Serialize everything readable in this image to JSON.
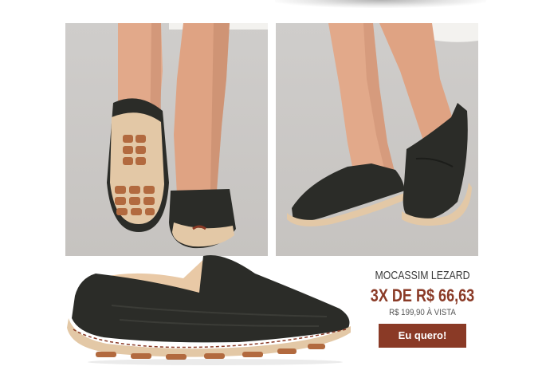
{
  "product": {
    "name": "MOCASSIM LEZARD",
    "installments": "3X DE R$ 66,63",
    "cash_price": "R$ 199,90 À VISTA",
    "cta_label": "Eu quero!"
  },
  "colors": {
    "accent": "#8a3a26",
    "shoe_leather": "#2b2c28",
    "sole": "#e2c7a8",
    "photo_background": "#cbc9c7"
  }
}
